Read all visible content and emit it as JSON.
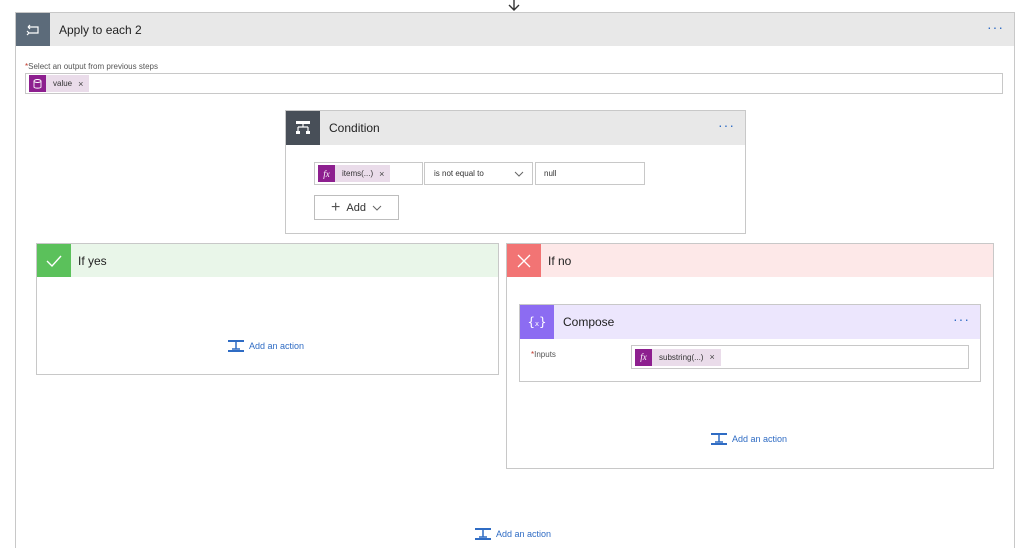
{
  "apply_each": {
    "title": "Apply to each 2",
    "field_label": "Select an output from previous steps",
    "token_label": "value"
  },
  "condition": {
    "title": "Condition",
    "token_label": "items(...)",
    "operator": "is not equal to",
    "value": "null",
    "add_label": "Add"
  },
  "if_yes": {
    "title": "If yes",
    "add_action_label": "Add an action"
  },
  "if_no": {
    "title": "If no",
    "add_action_label": "Add an action"
  },
  "compose": {
    "title": "Compose",
    "inputs_label": "Inputs",
    "token_label": "substring(...)"
  },
  "bottom": {
    "add_action_label": "Add an action"
  },
  "icons": {
    "apply_each": "loop-icon",
    "condition": "condition-icon",
    "if_yes": "checkmark-icon",
    "if_no": "close-x-icon",
    "compose": "braces-icon",
    "token_fx": "fx-icon",
    "token_value": "database-icon",
    "add_action": "add-action-icon"
  },
  "colors": {
    "loop_tile": "#5c6b7a",
    "condition_tile": "#484f58",
    "yes_tile": "#5bc15b",
    "no_tile": "#f27474",
    "compose_tile": "#8c6cf2",
    "token_purple": "#8d1f8f",
    "link_blue": "#2f6cc4"
  }
}
